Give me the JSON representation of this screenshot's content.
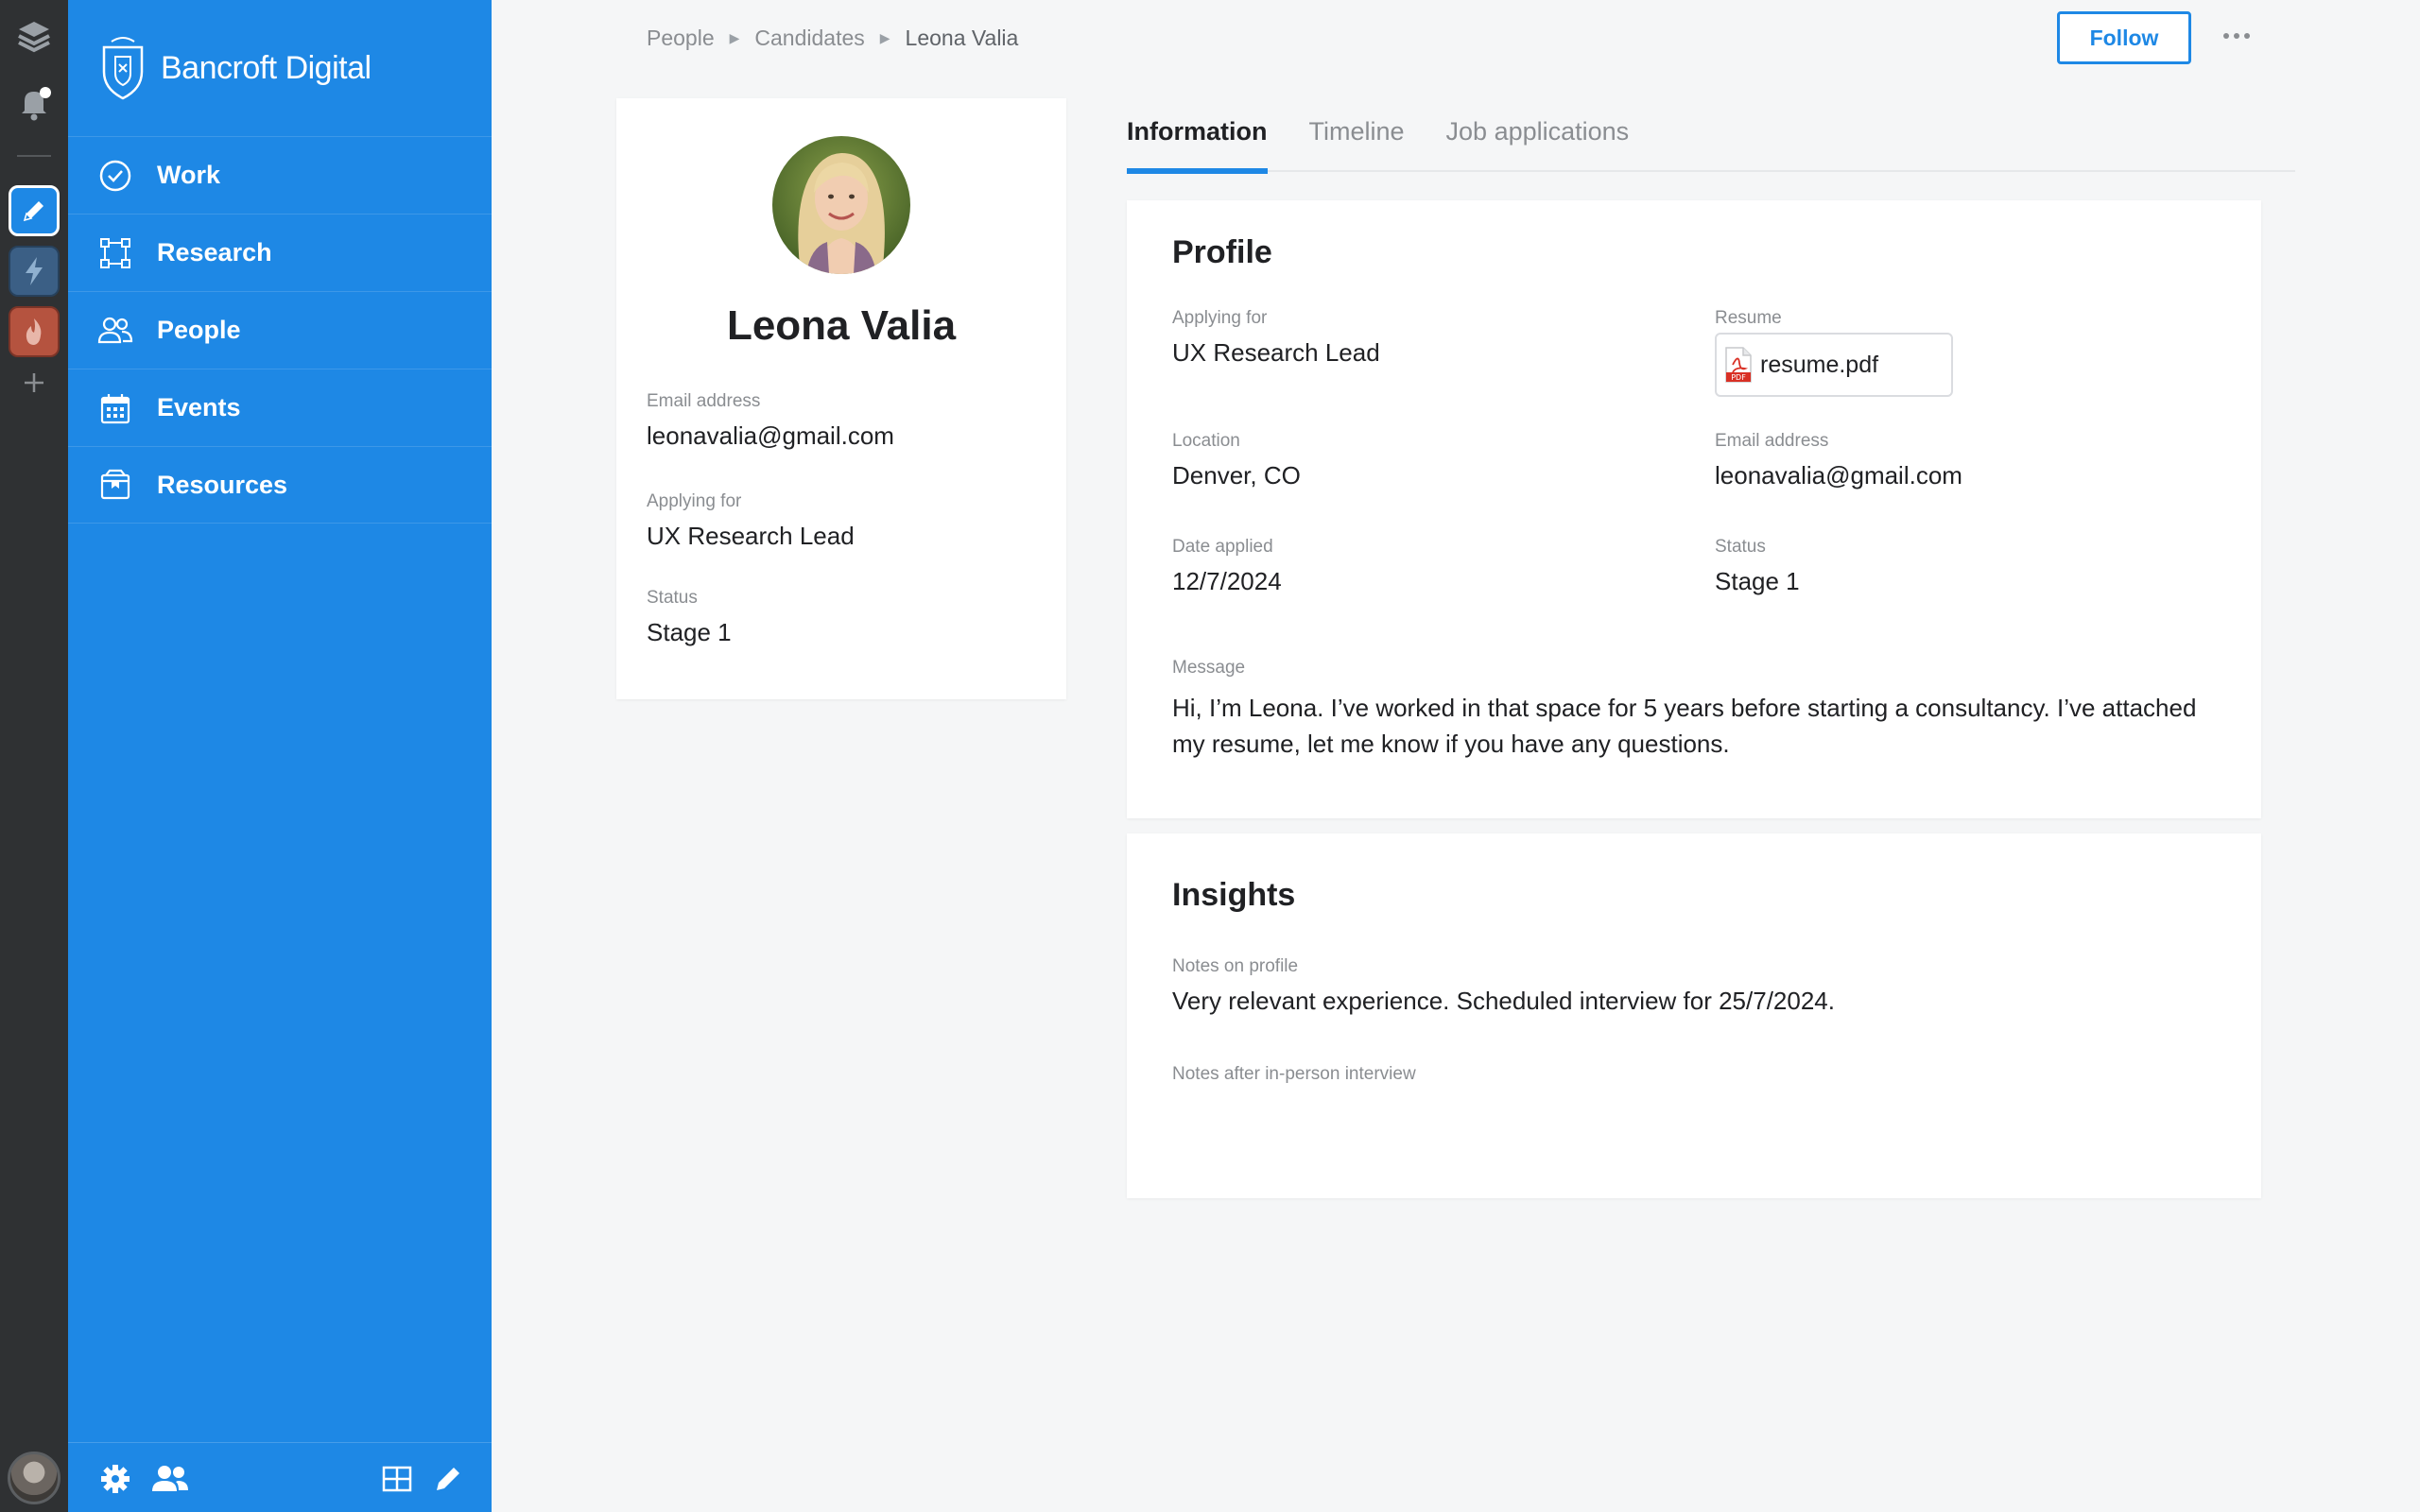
{
  "window": {
    "title": "Bancroft Digital — Leona Valia"
  },
  "rail": {
    "icons": [
      "layers-icon",
      "notification-bell-icon",
      "pencil-app-icon",
      "lightning-app-icon",
      "flame-app-icon",
      "add-icon",
      "user-avatar"
    ]
  },
  "brand": {
    "name": "Bancroft Digital",
    "logo": "shield-crest-icon"
  },
  "nav": {
    "items": [
      {
        "label": "Work",
        "icon": "check-circle-icon"
      },
      {
        "label": "Research",
        "icon": "frame-nodes-icon"
      },
      {
        "label": "People",
        "icon": "people-icon"
      },
      {
        "label": "Events",
        "icon": "calendar-icon"
      },
      {
        "label": "Resources",
        "icon": "box-icon"
      }
    ]
  },
  "footer": {
    "icons": [
      "settings-icon",
      "team-icon",
      "grid-icon",
      "edit-icon"
    ]
  },
  "breadcrumb": {
    "items": [
      "People",
      "Candidates"
    ],
    "current": "Leona Valia"
  },
  "actions": {
    "follow_label": "Follow",
    "more": "more-icon"
  },
  "candidate": {
    "name": "Leona Valia",
    "email_label": "Email address",
    "email": "leonavalia@gmail.com",
    "applying_label": "Applying for",
    "applying": "UX Research Lead",
    "status_label": "Status",
    "status": "Stage 1"
  },
  "tabs": [
    {
      "label": "Information",
      "active": true
    },
    {
      "label": "Timeline",
      "active": false
    },
    {
      "label": "Job applications",
      "active": false
    }
  ],
  "profile": {
    "title": "Profile",
    "applying_label": "Applying for",
    "applying": "UX Research Lead",
    "resume_label": "Resume",
    "resume_file": "resume.pdf",
    "pdf_badge": "PDF",
    "location_label": "Location",
    "location": "Denver, CO",
    "email_label": "Email address",
    "email": "leonavalia@gmail.com",
    "date_label": "Date applied",
    "date": "12/7/2024",
    "status_label": "Status",
    "status": "Stage 1",
    "message_label": "Message",
    "message": "Hi, I’m Leona. I’ve worked in that space for 5 years before starting a consultancy. I’ve attached my resume, let me know if you have any questions."
  },
  "insights": {
    "title": "Insights",
    "notes_profile_label": "Notes on profile",
    "notes_profile": "Very relevant experience. Scheduled interview for 25/7/2024.",
    "notes_interview_label": "Notes after in-person interview",
    "notes_interview": ""
  },
  "colors": {
    "accent": "#1e88e5",
    "rail": "#2f3133",
    "background": "#f5f6f7",
    "muted_text": "#8a8d91"
  }
}
